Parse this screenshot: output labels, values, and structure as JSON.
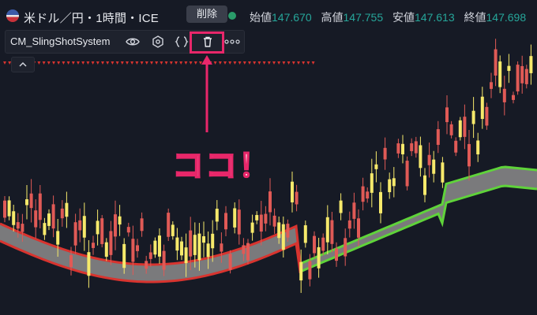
{
  "header": {
    "symbol_title": "米ドル／円・1時間・ICE",
    "delete_tooltip": "削除",
    "ohlc": [
      {
        "label": "始値",
        "value": "147.670"
      },
      {
        "label": "高値",
        "value": "147.755"
      },
      {
        "label": "安値",
        "value": "147.613"
      },
      {
        "label": "終値",
        "value": "147.698"
      }
    ]
  },
  "indicator": {
    "name": "CM_SlingShotSystem",
    "buttons": [
      "eye-icon",
      "settings-icon",
      "source-code-icon",
      "delete-icon",
      "more-icon"
    ]
  },
  "annotation": {
    "callout_text": "ココ！",
    "highlight_color": "#e8276a"
  },
  "colors": {
    "background": "#161a25",
    "bull_candle": "#f6e96b",
    "bear_candle": "#e05a56",
    "cloud_down": "#d8342f",
    "cloud_up": "#5fd33a",
    "cloud_fill": "#8c8c8c",
    "price_up": "#26a69a"
  }
}
